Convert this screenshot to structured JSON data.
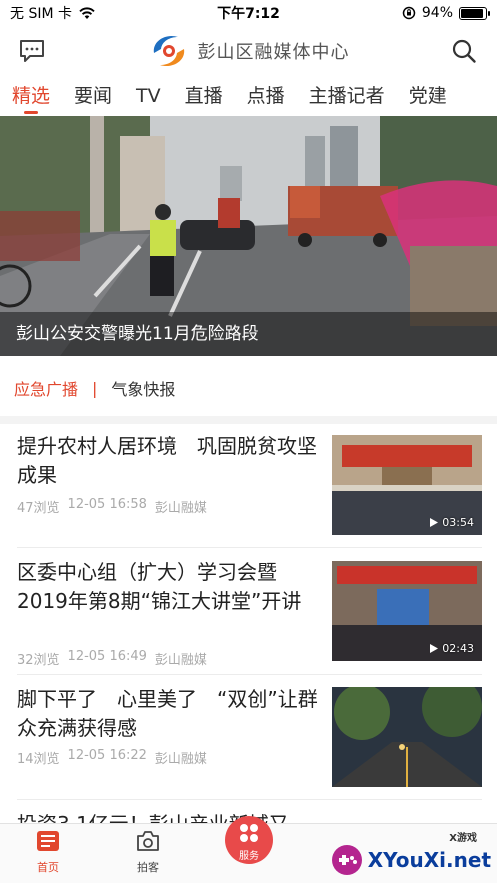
{
  "status": {
    "carrier": "无 SIM 卡",
    "time": "下午7:12",
    "battery": "94%",
    "battery_level": 0.94
  },
  "header": {
    "title": "彭山区融媒体中心"
  },
  "tabs": [
    {
      "label": "精选",
      "active": true
    },
    {
      "label": "要闻"
    },
    {
      "label": "TV"
    },
    {
      "label": "直播"
    },
    {
      "label": "点播"
    },
    {
      "label": "主播记者"
    },
    {
      "label": "党建"
    }
  ],
  "hero": {
    "caption": "彭山公安交警曝光11月危险路段"
  },
  "broadcast": {
    "alert": "应急广播",
    "separator": "|",
    "weather": "气象快报"
  },
  "news": [
    {
      "title": "提升农村人居环境　巩固脱贫攻坚成果",
      "views": "47浏览",
      "time": "12-05 16:58",
      "source": "彭山融媒",
      "duration": "03:54"
    },
    {
      "title": "区委中心组（扩大）学习会暨2019年第8期“锦江大讲堂”开讲",
      "views": "32浏览",
      "time": "12-05 16:49",
      "source": "彭山融媒",
      "duration": "02:43"
    },
    {
      "title": "脚下平了　心里美了　“双创”让群众充满获得感",
      "views": "14浏览",
      "time": "12-05 16:22",
      "source": "彭山融媒"
    },
    {
      "title": "投资3.1亿元！彭山产业新城又"
    }
  ],
  "nav": {
    "home": "首页",
    "shoot": "拍客",
    "service": "服务"
  },
  "watermark": {
    "brand": "XYouXi.net",
    "small": "X游戏"
  },
  "colors": {
    "accent": "#e1472e",
    "watermark": "#0a3d9c"
  }
}
